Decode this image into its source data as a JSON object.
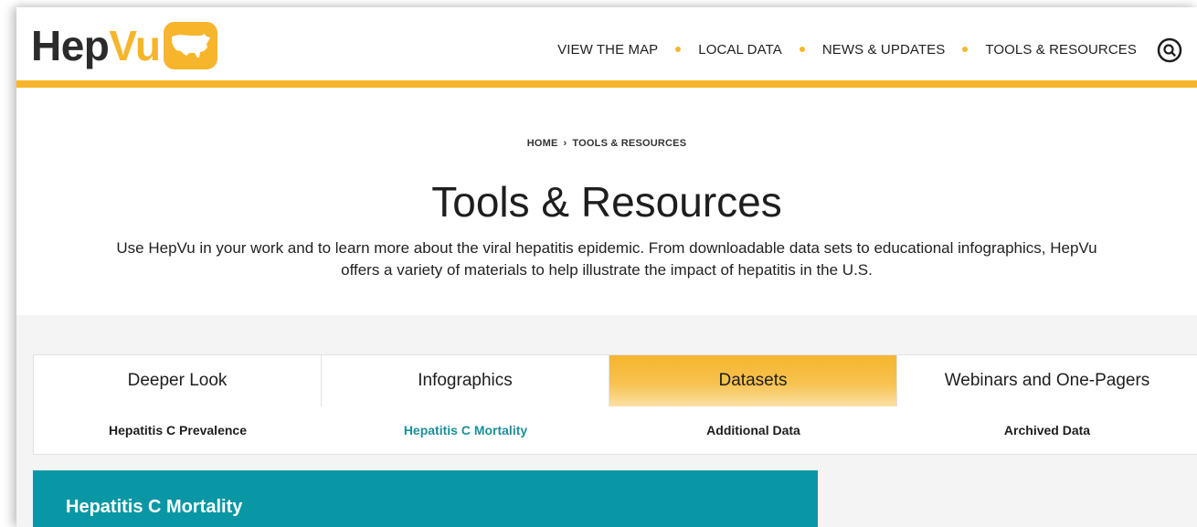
{
  "header": {
    "logo": {
      "part1": "Hep",
      "part2": "Vu",
      "badge_icon": "us-map-icon"
    },
    "nav": [
      {
        "label": "VIEW THE MAP"
      },
      {
        "label": "LOCAL DATA"
      },
      {
        "label": "NEWS & UPDATES"
      },
      {
        "label": "TOOLS & RESOURCES"
      }
    ],
    "search_icon": "search-icon"
  },
  "breadcrumb": {
    "home": "HOME",
    "separator": "›",
    "current": "TOOLS & RESOURCES"
  },
  "page_title": "Tools & Resources",
  "intro": "Use HepVu in your work and to learn more about the viral hepatitis epidemic. From downloadable data sets to educational infographics, HepVu offers a variety of materials to help illustrate the impact of hepatitis in the U.S.",
  "tabs": [
    {
      "label": "Deeper Look",
      "active": false
    },
    {
      "label": "Infographics",
      "active": false
    },
    {
      "label": "Datasets",
      "active": true
    },
    {
      "label": "Webinars and One-Pagers",
      "active": false
    }
  ],
  "subtabs": [
    {
      "label": "Hepatitis C Prevalence",
      "active": false
    },
    {
      "label": "Hepatitis C Mortality",
      "active": true
    },
    {
      "label": "Additional Data",
      "active": false
    },
    {
      "label": "Archived Data",
      "active": false
    }
  ],
  "section": {
    "title": "Hepatitis C Mortality"
  },
  "colors": {
    "brand_yellow": "#f7b52c",
    "teal": "#0a97a5",
    "active_subtab": "#1e8f9a"
  }
}
